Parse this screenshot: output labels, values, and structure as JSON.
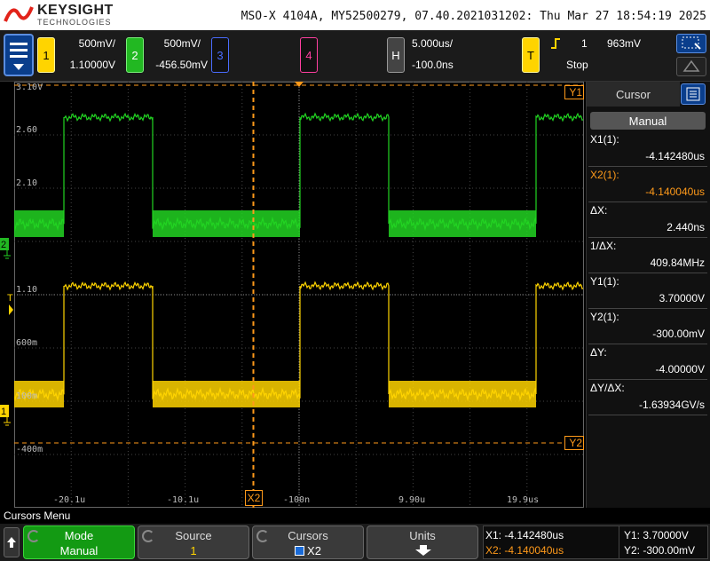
{
  "brand": {
    "name": "KEYSIGHT",
    "sub": "TECHNOLOGIES"
  },
  "header_info": "MSO-X 4104A, MY52500279, 07.40.2021031202: Thu Mar 27 18:54:19 2025",
  "channels": [
    {
      "num": "1",
      "scale": "500mV/",
      "offset": "1.10000V",
      "color": "#ffd400"
    },
    {
      "num": "2",
      "scale": "500mV/",
      "offset": "-456.50mV",
      "color": "#22d422"
    },
    {
      "num": "3",
      "color": "#4a6cff"
    },
    {
      "num": "4",
      "color": "#ff3fa0"
    }
  ],
  "horizontal": {
    "tag": "H",
    "scale": "5.000us/",
    "delay": "-100.0ns"
  },
  "trigger": {
    "tag": "T",
    "source": "1",
    "level": "963mV",
    "state": "Stop"
  },
  "graticule": {
    "levels": [
      "3.10V",
      "2.60",
      "2.10",
      "1.10",
      "600m",
      "100m",
      "-400m"
    ],
    "time_labels": [
      "-20.1u",
      "-10.1u",
      "-100n",
      "9.90u",
      "19.9us"
    ],
    "cursor_labels": {
      "x2": "X2",
      "y1": "Y1",
      "y2": "Y2"
    }
  },
  "sidebar": {
    "title": "Cursor",
    "mode": "Manual",
    "rows": [
      {
        "label": "X1(1):",
        "value": "-4.142480us"
      },
      {
        "label": "X2(1):",
        "value": "-4.140040us",
        "highlight": true
      },
      {
        "label": "ΔX:",
        "value": "2.440ns"
      },
      {
        "label": "1/ΔX:",
        "value": "409.84MHz"
      },
      {
        "label": "Y1(1):",
        "value": "3.70000V"
      },
      {
        "label": "Y2(1):",
        "value": "-300.00mV"
      },
      {
        "label": "ΔY:",
        "value": "-4.00000V"
      },
      {
        "label": "ΔY/ΔX:",
        "value": "-1.63934GV/s"
      }
    ]
  },
  "menu": {
    "title": "Cursors Menu",
    "softkeys": [
      {
        "label": "Mode",
        "value": "Manual"
      },
      {
        "label": "Source",
        "value": "1"
      },
      {
        "label": "Cursors",
        "value": "X2"
      },
      {
        "label": "Units"
      }
    ]
  },
  "readout": {
    "x1": "X1: -4.142480us",
    "x2": "X2: -4.140040us",
    "y1": "Y1: 3.70000V",
    "y2": "Y2: -300.00mV"
  },
  "colors": {
    "ch1": "#ffd400",
    "ch2": "#22d422",
    "cursor": "#ff9a1a",
    "grid": "#555555"
  }
}
